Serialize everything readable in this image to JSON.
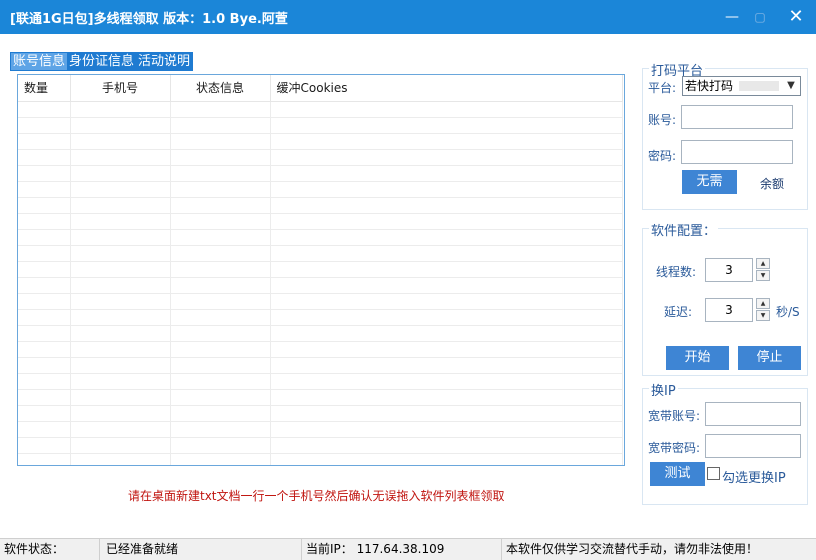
{
  "window": {
    "title": "[联通1G日包]多线程领取     版本：1.0     Bye.阿萱"
  },
  "tabs": [
    {
      "label": "账号信息"
    },
    {
      "label": "身份证信息"
    },
    {
      "label": "活动说明"
    }
  ],
  "table": {
    "columns": [
      "数量",
      "手机号",
      "状态信息",
      "缓冲Cookies"
    ],
    "rows": []
  },
  "hint": "请在桌面新建txt文档一行一个手机号然后确认无误拖入软件列表框领取",
  "captcha": {
    "title": "打码平台",
    "platform_label": "平台:",
    "platform_value": "若快打码",
    "account_label": "账号:",
    "account_value": "",
    "password_label": "密码:",
    "password_value": "",
    "btn_label": "无需",
    "balance_label": "余额"
  },
  "config": {
    "title": "软件配置：",
    "threads_label": "线程数:",
    "threads_value": "3",
    "delay_label": "延迟:",
    "delay_value": "3",
    "delay_unit": "秒/S",
    "start_label": "开始",
    "stop_label": "停止"
  },
  "ip": {
    "title": "换IP",
    "account_label": "宽带账号:",
    "account_value": "",
    "password_label": "宽带密码:",
    "password_value": "",
    "test_label": "测试",
    "check_label": "勾选更换IP",
    "checked": false
  },
  "statusbar": {
    "state_label": "软件状态：",
    "state_value": "已经准备就绪",
    "ip_text": "当前IP：  117.64.38.109",
    "notice": "本软件仅供学习交流替代手动，请勿非法使用！"
  }
}
